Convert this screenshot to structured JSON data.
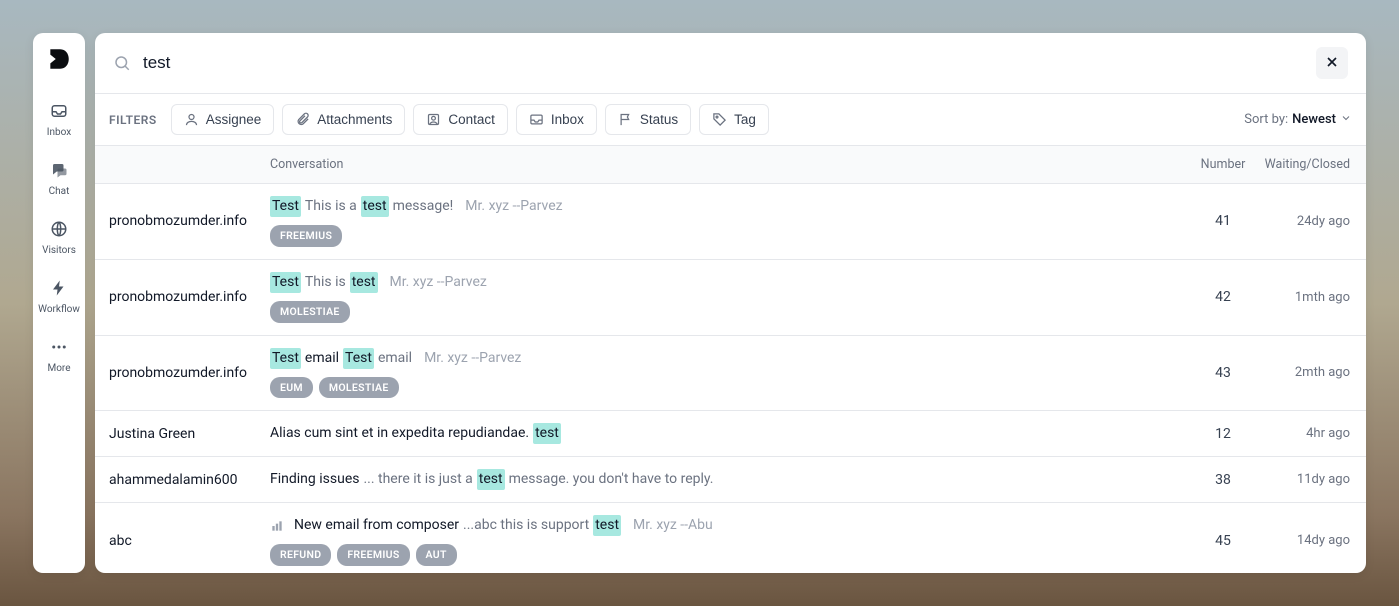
{
  "sidebar": {
    "items": [
      {
        "label": "Inbox"
      },
      {
        "label": "Chat"
      },
      {
        "label": "Visitors"
      },
      {
        "label": "Workflow"
      },
      {
        "label": "More"
      }
    ]
  },
  "search": {
    "value": "test"
  },
  "filters": {
    "label": "FILTERS",
    "buttons": {
      "assignee": "Assignee",
      "attachments": "Attachments",
      "contact": "Contact",
      "inbox": "Inbox",
      "status": "Status",
      "tag": "Tag"
    }
  },
  "sort": {
    "label": "Sort by:",
    "value": "Newest"
  },
  "headers": {
    "conversation": "Conversation",
    "number": "Number",
    "waiting": "Waiting/Closed"
  },
  "rows": [
    {
      "sender": "pronobmozumder.info",
      "segments": [
        {
          "text": "Test",
          "type": "hl"
        },
        {
          "text": " This is a ",
          "type": "preview"
        },
        {
          "text": "test",
          "type": "hl"
        },
        {
          "text": " message!",
          "type": "preview"
        },
        {
          "text": "Mr. xyz --Parvez",
          "type": "meta"
        }
      ],
      "tags": [
        "FREEMIUS"
      ],
      "number": "41",
      "waiting": "24dy ago"
    },
    {
      "sender": "pronobmozumder.info",
      "segments": [
        {
          "text": "Test",
          "type": "hl"
        },
        {
          "text": " This is ",
          "type": "preview"
        },
        {
          "text": "test",
          "type": "hl"
        },
        {
          "text": "Mr. xyz --Parvez",
          "type": "meta"
        }
      ],
      "tags": [
        "MOLESTIAE"
      ],
      "number": "42",
      "waiting": "1mth ago"
    },
    {
      "sender": "pronobmozumder.info",
      "segments": [
        {
          "text": "Test",
          "type": "hl"
        },
        {
          "text": " email ",
          "type": "title"
        },
        {
          "text": "Test",
          "type": "hl"
        },
        {
          "text": " email",
          "type": "preview"
        },
        {
          "text": "Mr. xyz --Parvez",
          "type": "meta"
        }
      ],
      "tags": [
        "EUM",
        "MOLESTIAE"
      ],
      "number": "43",
      "waiting": "2mth ago"
    },
    {
      "sender": "Justina Green",
      "segments": [
        {
          "text": "Alias cum sint et in expedita repudiandae. ",
          "type": "title"
        },
        {
          "text": "test",
          "type": "hl"
        }
      ],
      "tags": [],
      "number": "12",
      "waiting": "4hr ago"
    },
    {
      "sender": "ahammedalamin600",
      "segments": [
        {
          "text": "Finding issues ",
          "type": "title"
        },
        {
          "text": "... there it is just a ",
          "type": "preview"
        },
        {
          "text": "test",
          "type": "hl"
        },
        {
          "text": " message. you don't have to reply.",
          "type": "preview"
        }
      ],
      "tags": [],
      "number": "38",
      "waiting": "11dy ago"
    },
    {
      "sender": "abc",
      "hasBarIcon": true,
      "segments": [
        {
          "text": "New email from composer ",
          "type": "title"
        },
        {
          "text": "...abc this is support ",
          "type": "preview"
        },
        {
          "text": "test",
          "type": "hl"
        },
        {
          "text": "Mr. xyz --Abu",
          "type": "meta"
        }
      ],
      "tags": [
        "REFUND",
        "FREEMIUS",
        "AUT"
      ],
      "number": "45",
      "waiting": "14dy ago"
    }
  ]
}
